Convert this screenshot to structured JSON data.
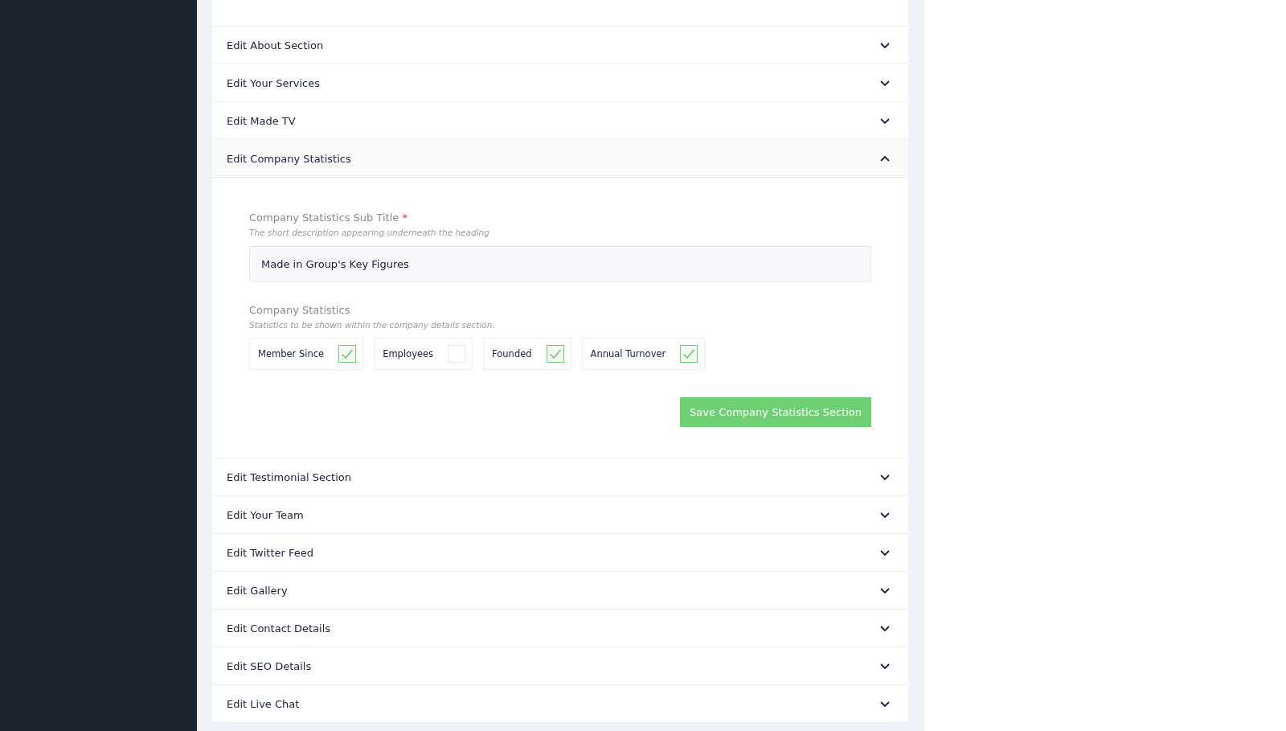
{
  "sections": [
    {
      "title": "Edit About Section",
      "expanded": false
    },
    {
      "title": "Edit Your Services",
      "expanded": false
    },
    {
      "title": "Edit Made TV",
      "expanded": false
    },
    {
      "title": "Edit Company Statistics",
      "expanded": true,
      "form": {
        "subtitle_field": {
          "label": "Company Statistics Sub Title",
          "required_mark": "*",
          "hint": "The short description appearing underneath the heading",
          "value": "Made in Group's Key Figures"
        },
        "statistics": {
          "label": "Company Statistics",
          "hint": "Statistics to be shown within the company details section.",
          "options": [
            {
              "label": "Member Since",
              "checked": true
            },
            {
              "label": "Employees",
              "checked": false
            },
            {
              "label": "Founded",
              "checked": true
            },
            {
              "label": "Annual Turnover",
              "checked": true
            }
          ]
        },
        "save_button": "Save Company Statistics Section"
      }
    },
    {
      "title": "Edit Testimonial Section",
      "expanded": false
    },
    {
      "title": "Edit Your Team",
      "expanded": false
    },
    {
      "title": "Edit Twitter Feed",
      "expanded": false
    },
    {
      "title": "Edit Gallery",
      "expanded": false
    },
    {
      "title": "Edit Contact Details",
      "expanded": false
    },
    {
      "title": "Edit SEO Details",
      "expanded": false
    },
    {
      "title": "Edit Live Chat",
      "expanded": false
    }
  ]
}
